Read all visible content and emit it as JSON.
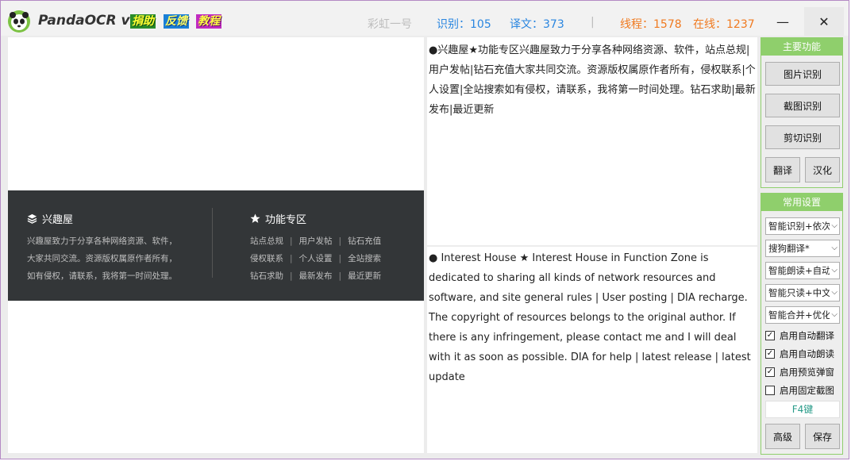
{
  "titlebar": {
    "app_title": "PandaOCR v2.5",
    "badges": [
      "捐助",
      "反馈",
      "教程"
    ],
    "engine": "彩虹一号",
    "recognize": "识别：105",
    "translate": "译文：373",
    "separator": "|",
    "threads": "线程：1578",
    "online": "在线：1237",
    "minimize": "—",
    "close": "✕"
  },
  "left_pane": {
    "col1_title": "兴趣屋",
    "col1_lines": [
      "兴趣屋致力于分享各种网络资源、软件，",
      "大家共同交流。资源版权属原作者所有，",
      "如有侵权，请联系，我将第一时间处理。"
    ],
    "col2_title": "功能专区",
    "links_row1": [
      "站点总规",
      "用户发帖",
      "钻石充值"
    ],
    "links_row2": [
      "侵权联系",
      "个人设置",
      "全站搜索"
    ],
    "links_row3": [
      "钻石求助",
      "最新发布",
      "最近更新"
    ],
    "pipe": "|"
  },
  "ocr_text": "●兴趣屋★功能专区兴趣屋致力于分享各种网络资源、软件，站点总规|用户发帖|钻石充值大家共同交流。资源版权属原作者所有，侵权联系|个人设置|全站搜索如有侵权，请联系，我将第一时间处理。钻石求助|最新发布|最近更新",
  "translation_text": "● Interest House ★ Interest House in Function Zone is dedicated to sharing all kinds of network resources and software, and site general rules | User posting | DIA recharge.  The copyright of resources belongs to the original author. If there is any infringement, please contact me and I will deal with it as soon as possible.  DIA for help | latest release | latest update",
  "main_functions": {
    "header": "主要功能",
    "image_ocr": "图片识别",
    "screenshot_ocr": "截图识别",
    "clipboard_ocr": "剪切识别",
    "translate": "翻译",
    "localize": "汉化"
  },
  "common_settings": {
    "header": "常用设置",
    "selects": [
      "智能识别+依次",
      "搜狗翻译*",
      "智能朗读+自动",
      "智能只读+中文",
      "智能合并+优化"
    ],
    "checkboxes": [
      {
        "label": "启用自动翻译",
        "checked": true
      },
      {
        "label": "启用自动朗读",
        "checked": true
      },
      {
        "label": "启用预览弹窗",
        "checked": true
      },
      {
        "label": "启用固定截图",
        "checked": false
      }
    ],
    "check_mark": "✓",
    "chevron": "⌵",
    "hotkey": "F4键",
    "advanced": "高级",
    "save": "保存"
  }
}
